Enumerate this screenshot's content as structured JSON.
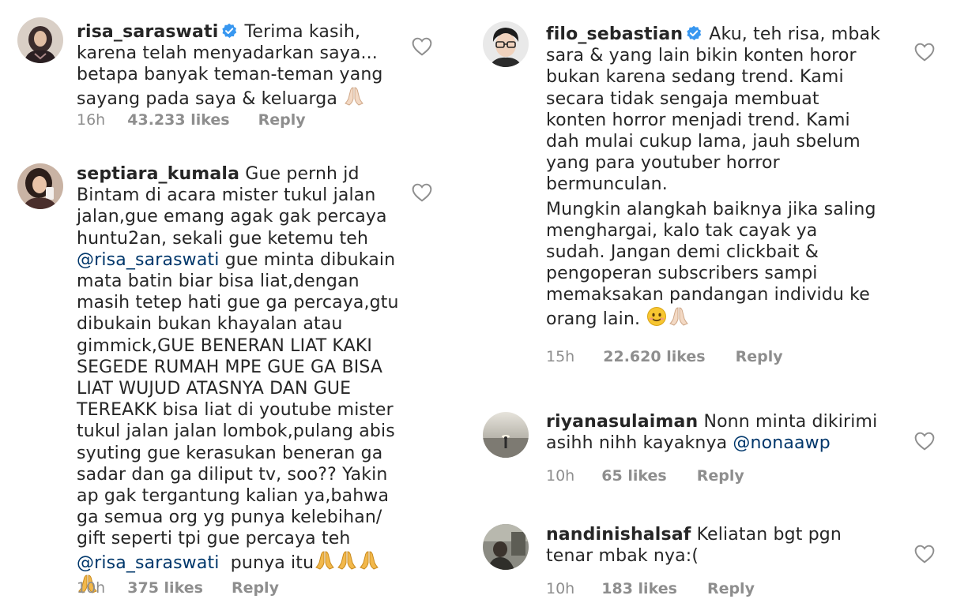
{
  "comments": [
    {
      "username": "risa_saraswati",
      "verified": true,
      "lines": [
        "Terima kasih,",
        "karena telah menyadarkan saya...",
        "betapa banyak teman-teman yang",
        "sayang pada saya & keluarga"
      ],
      "time": "16h",
      "likes": "43.233 likes",
      "reply": "Reply"
    },
    {
      "username": "septiara_kumala",
      "verified": false,
      "lines": [
        "Gue pernh jd",
        "Bintam di acara mister tukul jalan",
        "jalan,gue emang  agak gak percaya",
        "huntu2an, sekali gue ketemu teh",
        "gue minta dibukain",
        "mata batin biar bisa liat,dengan",
        "masih tetep hati gue ga percaya,gtu",
        "dibukain bukan khayalan atau",
        "gimmick,GUE BENERAN LIAT KAKI",
        "SEGEDE RUMAH MPE GUE GA BISA",
        "LIAT WUJUD ATASNYA DAN GUE",
        "TEREAKK bisa liat di youtube mister",
        "tukul jalan jalan lombok,pulang abis",
        "syuting gue kerasukan beneran ga",
        "sadar dan ga diliput tv, soo?? Yakin",
        "ap gak tergantung kalian ya,bahwa",
        "ga semua org yg punya kelebihan/",
        "gift seperti tpi gue percaya teh",
        "punya itu"
      ],
      "mention1": "@risa_saraswati",
      "mention2": "@risa_saraswati",
      "time": "10h",
      "likes": "375 likes",
      "reply": "Reply"
    },
    {
      "username": "filo_sebastian",
      "verified": true,
      "lines": [
        "Aku, teh risa, mbak",
        "sara & yang lain bikin konten horor",
        "bukan karena sedang trend. Kami",
        "secara tidak sengaja membuat",
        "konten horror menjadi trend. Kami",
        "dah mulai cukup lama, jauh sbelum",
        "yang para youtuber horror",
        "bermunculan."
      ],
      "lines2": [
        "Mungkin alangkah baiknya jika saling",
        "menghargai, kalo tak cayak ya",
        "sudah. Jangan demi clickbait &",
        "pengoperan subscribers sampi",
        "memaksakan pandangan individu ke",
        "orang lain."
      ],
      "time": "15h",
      "likes": "22.620 likes",
      "reply": "Reply"
    },
    {
      "username": "riyanasulaiman",
      "verified": false,
      "lines": [
        "Nonn minta dikirimi",
        "asihh nihh kayaknya"
      ],
      "mention": "@nonaawp",
      "time": "10h",
      "likes": "65 likes",
      "reply": "Reply"
    },
    {
      "username": "nandinishalsaf",
      "verified": false,
      "lines": [
        "Keliatan bgt pgn",
        "tenar mbak nya:("
      ],
      "time": "10h",
      "likes": "183 likes",
      "reply": "Reply"
    }
  ],
  "icons": {
    "like": "heart-outline-icon",
    "verified": "verified-badge-icon",
    "pray": "folded-hands-emoji",
    "smile": "smiling-face-emoji"
  },
  "colors": {
    "text": "#262626",
    "meta": "#8e8e8e",
    "mention": "#00376b",
    "verified": "#3897f0"
  }
}
